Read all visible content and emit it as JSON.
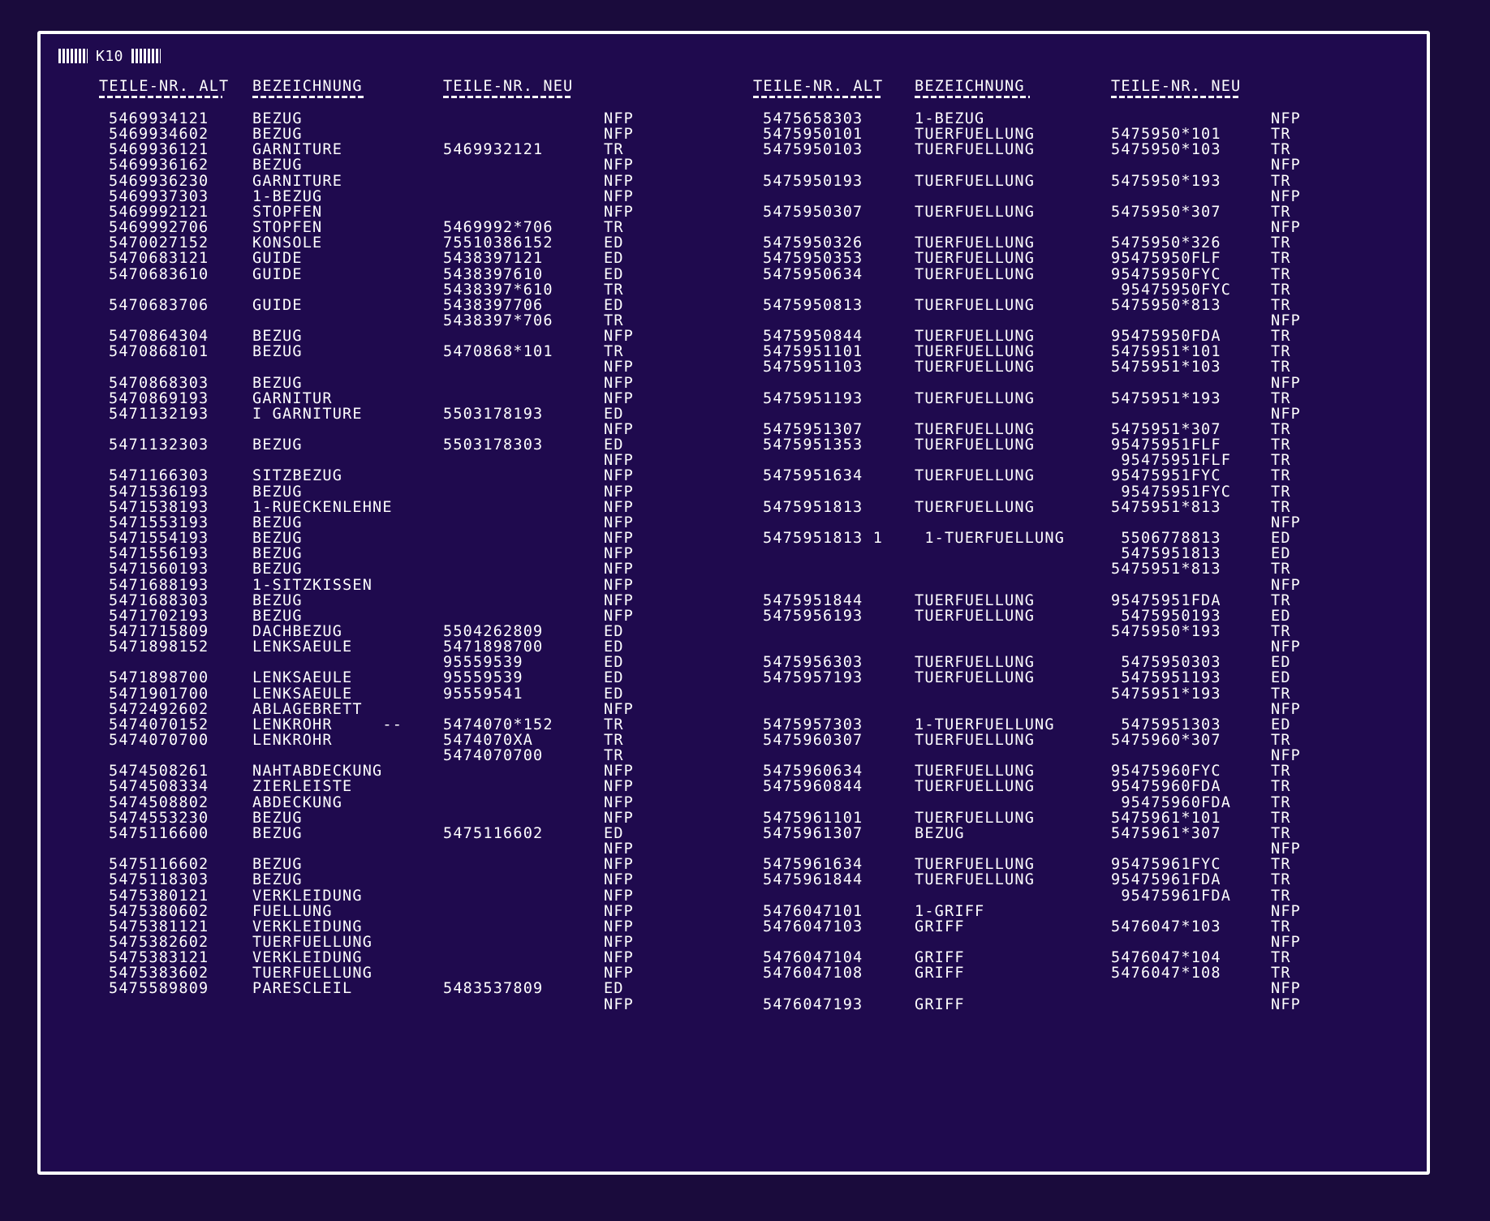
{
  "header_label": "K10",
  "column_headers": {
    "left": [
      "TEILE-NR. ALT",
      "BEZEICHNUNG",
      "TEILE-NR. NEU"
    ],
    "right": [
      "TEILE-NR. ALT",
      "BEZEICHNUNG",
      "TEILE-NR. NEU"
    ]
  },
  "left_rows": [
    [
      "5469934121",
      "BEZUG",
      "",
      "NFP"
    ],
    [
      "5469934602",
      "BEZUG",
      "",
      "NFP"
    ],
    [
      "5469936121",
      "GARNITURE",
      "5469932121",
      "TR"
    ],
    [
      "5469936162",
      "BEZUG",
      "",
      "NFP"
    ],
    [
      "5469936230",
      "GARNITURE",
      "",
      "NFP"
    ],
    [
      "5469937303",
      "1-BEZUG",
      "",
      "NFP"
    ],
    [
      "5469992121",
      "STOPFEN",
      "",
      "NFP"
    ],
    [
      "5469992706",
      "STOPFEN",
      "5469992*706",
      "TR"
    ],
    [
      "5470027152",
      "KONSOLE",
      "75510386152",
      "ED"
    ],
    [
      "5470683121",
      "GUIDE",
      "5438397121",
      "ED"
    ],
    [
      "5470683610",
      "GUIDE",
      "5438397610",
      "ED"
    ],
    [
      "",
      "",
      "5438397*610",
      "TR"
    ],
    [
      "5470683706",
      "GUIDE",
      "5438397706",
      "ED"
    ],
    [
      "",
      "",
      "5438397*706",
      "TR"
    ],
    [
      "5470864304",
      "BEZUG",
      "",
      "NFP"
    ],
    [
      "5470868101",
      "BEZUG",
      "5470868*101",
      "TR"
    ],
    [
      "",
      "",
      "",
      "NFP"
    ],
    [
      "5470868303",
      "BEZUG",
      "",
      "NFP"
    ],
    [
      "5470869193",
      "GARNITUR",
      "",
      "NFP"
    ],
    [
      "5471132193",
      "I GARNITURE",
      "5503178193",
      "ED"
    ],
    [
      "",
      "",
      "",
      "NFP"
    ],
    [
      "5471132303",
      "BEZUG",
      "5503178303",
      "ED"
    ],
    [
      "",
      "",
      "",
      "NFP"
    ],
    [
      "5471166303",
      "SITZBEZUG",
      "",
      "NFP"
    ],
    [
      "5471536193",
      "BEZUG",
      "",
      "NFP"
    ],
    [
      "5471538193",
      "1-RUECKENLEHNE",
      "",
      "NFP"
    ],
    [
      "5471553193",
      "BEZUG",
      "",
      "NFP"
    ],
    [
      "5471554193",
      "BEZUG",
      "",
      "NFP"
    ],
    [
      "5471556193",
      "BEZUG",
      "",
      "NFP"
    ],
    [
      "5471560193",
      "BEZUG",
      "",
      "NFP"
    ],
    [
      "5471688193",
      "1-SITZKISSEN",
      "",
      "NFP"
    ],
    [
      "5471688303",
      "BEZUG",
      "",
      "NFP"
    ],
    [
      "5471702193",
      "BEZUG",
      "",
      "NFP"
    ],
    [
      "5471715809",
      "DACHBEZUG",
      "5504262809",
      "ED"
    ],
    [
      "5471898152",
      "LENKSAEULE",
      "5471898700",
      "ED"
    ],
    [
      "",
      "",
      "95559539",
      "ED"
    ],
    [
      "5471898700",
      "LENKSAEULE",
      "95559539",
      "ED"
    ],
    [
      "5471901700",
      "LENKSAEULE",
      "95559541",
      "ED"
    ],
    [
      "5472492602",
      "ABLAGEBRETT",
      "",
      "NFP"
    ],
    [
      "5474070152",
      "LENKROHR     --",
      "5474070*152",
      "TR"
    ],
    [
      "5474070700",
      "LENKROHR",
      "5474070XA",
      "TR"
    ],
    [
      "",
      "",
      "5474070700",
      "TR"
    ],
    [
      "5474508261",
      "NAHTABDECKUNG",
      "",
      "NFP"
    ],
    [
      "5474508334",
      "ZIERLEISTE",
      "",
      "NFP"
    ],
    [
      "5474508802",
      "ABDECKUNG",
      "",
      "NFP"
    ],
    [
      "5474553230",
      "BEZUG",
      "",
      "NFP"
    ],
    [
      "5475116600",
      "BEZUG",
      "5475116602",
      "ED"
    ],
    [
      "",
      "",
      "",
      "NFP"
    ],
    [
      "5475116602",
      "BEZUG",
      "",
      "NFP"
    ],
    [
      "5475118303",
      "BEZUG",
      "",
      "NFP"
    ],
    [
      "5475380121",
      "VERKLEIDUNG",
      "",
      "NFP"
    ],
    [
      "5475380602",
      "FUELLUNG",
      "",
      "NFP"
    ],
    [
      "5475381121",
      "VERKLEIDUNG",
      "",
      "NFP"
    ],
    [
      "5475382602",
      "TUERFUELLUNG",
      "",
      "NFP"
    ],
    [
      "5475383121",
      "VERKLEIDUNG",
      "",
      "NFP"
    ],
    [
      "5475383602",
      "TUERFUELLUNG",
      "",
      "NFP"
    ],
    [
      "5475589809",
      "PARESCLEIL",
      "5483537809",
      "ED"
    ],
    [
      "",
      "",
      "",
      "NFP"
    ]
  ],
  "right_rows": [
    [
      "5475658303",
      "1-BEZUG",
      "",
      "NFP"
    ],
    [
      "5475950101",
      "TUERFUELLUNG",
      "5475950*101",
      "TR"
    ],
    [
      "5475950103",
      "TUERFUELLUNG",
      "5475950*103",
      "TR"
    ],
    [
      "",
      "",
      "",
      "NFP"
    ],
    [
      "5475950193",
      "TUERFUELLUNG",
      "5475950*193",
      "TR"
    ],
    [
      "",
      "",
      "",
      "NFP"
    ],
    [
      "5475950307",
      "TUERFUELLUNG",
      "5475950*307",
      "TR"
    ],
    [
      "",
      "",
      "",
      "NFP"
    ],
    [
      "5475950326",
      "TUERFUELLUNG",
      "5475950*326",
      "TR"
    ],
    [
      "5475950353",
      "TUERFUELLUNG",
      "95475950FLF",
      "TR"
    ],
    [
      "5475950634",
      "TUERFUELLUNG",
      "95475950FYC",
      "TR"
    ],
    [
      "",
      "",
      " 95475950FYC",
      "TR"
    ],
    [
      "5475950813",
      "TUERFUELLUNG",
      "5475950*813",
      "TR"
    ],
    [
      "",
      "",
      "",
      "NFP"
    ],
    [
      "5475950844",
      "TUERFUELLUNG",
      "95475950FDA",
      "TR"
    ],
    [
      "5475951101",
      "TUERFUELLUNG",
      "5475951*101",
      "TR"
    ],
    [
      "5475951103",
      "TUERFUELLUNG",
      "5475951*103",
      "TR"
    ],
    [
      "",
      "",
      "",
      "NFP"
    ],
    [
      "5475951193",
      "TUERFUELLUNG",
      "5475951*193",
      "TR"
    ],
    [
      "",
      "",
      "",
      "NFP"
    ],
    [
      "5475951307",
      "TUERFUELLUNG",
      "5475951*307",
      "TR"
    ],
    [
      "5475951353",
      "TUERFUELLUNG",
      "95475951FLF",
      "TR"
    ],
    [
      "",
      "",
      " 95475951FLF",
      "TR"
    ],
    [
      "5475951634",
      "TUERFUELLUNG",
      "95475951FYC",
      "TR"
    ],
    [
      "",
      "",
      " 95475951FYC",
      "TR"
    ],
    [
      "5475951813",
      "TUERFUELLUNG",
      "5475951*813",
      "TR"
    ],
    [
      "",
      "",
      "",
      "NFP"
    ],
    [
      "5475951813 1",
      " 1-TUERFUELLUNG",
      " 5506778813",
      "ED"
    ],
    [
      "",
      "",
      " 5475951813",
      "ED"
    ],
    [
      "",
      "",
      "5475951*813",
      "TR"
    ],
    [
      "",
      "",
      "",
      "NFP"
    ],
    [
      "5475951844",
      "TUERFUELLUNG",
      "95475951FDA",
      "TR"
    ],
    [
      "5475956193",
      "TUERFUELLUNG",
      " 5475950193",
      "ED"
    ],
    [
      "",
      "",
      "5475950*193",
      "TR"
    ],
    [
      "",
      "",
      "",
      "NFP"
    ],
    [
      "5475956303",
      "TUERFUELLUNG",
      " 5475950303",
      "ED"
    ],
    [
      "5475957193",
      "TUERFUELLUNG",
      " 5475951193",
      "ED"
    ],
    [
      "",
      "",
      "5475951*193",
      "TR"
    ],
    [
      "",
      "",
      "",
      "NFP"
    ],
    [
      "5475957303",
      "1-TUERFUELLUNG",
      " 5475951303",
      "ED"
    ],
    [
      "5475960307",
      "TUERFUELLUNG",
      "5475960*307",
      "TR"
    ],
    [
      "",
      "",
      "",
      "NFP"
    ],
    [
      "5475960634",
      "TUERFUELLUNG",
      "95475960FYC",
      "TR"
    ],
    [
      "5475960844",
      "TUERFUELLUNG",
      "95475960FDA",
      "TR"
    ],
    [
      "",
      "",
      " 95475960FDA",
      "TR"
    ],
    [
      "5475961101",
      "TUERFUELLUNG",
      "5475961*101",
      "TR"
    ],
    [
      "5475961307",
      "BEZUG",
      "5475961*307",
      "TR"
    ],
    [
      "",
      "",
      "",
      "NFP"
    ],
    [
      "5475961634",
      "TUERFUELLUNG",
      "95475961FYC",
      "TR"
    ],
    [
      "5475961844",
      "TUERFUELLUNG",
      "95475961FDA",
      "TR"
    ],
    [
      "",
      "",
      " 95475961FDA",
      "TR"
    ],
    [
      "5476047101",
      "1-GRIFF",
      "",
      "NFP"
    ],
    [
      "5476047103",
      "GRIFF",
      "5476047*103",
      "TR"
    ],
    [
      "",
      "",
      "",
      "NFP"
    ],
    [
      "5476047104",
      "GRIFF",
      "5476047*104",
      "TR"
    ],
    [
      "5476047108",
      "GRIFF",
      "5476047*108",
      "TR"
    ],
    [
      "",
      "",
      "",
      "NFP"
    ],
    [
      "5476047193",
      "GRIFF",
      "",
      "NFP"
    ]
  ]
}
